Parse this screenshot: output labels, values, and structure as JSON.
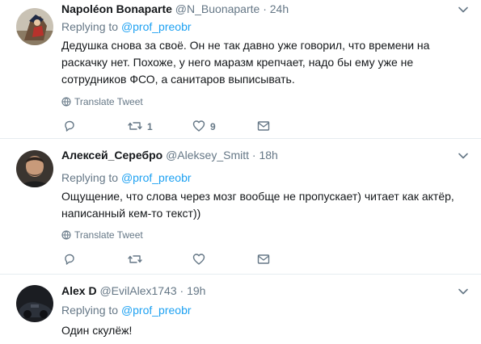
{
  "icons": {
    "caret": "chevron-down-icon",
    "translate": "globe-icon",
    "reply": "reply-icon",
    "retweet": "retweet-icon",
    "like": "heart-icon",
    "dm": "envelope-icon"
  },
  "colors": {
    "link": "#1da1f2",
    "secondary_text": "#657786",
    "primary_text": "#14171a",
    "divider": "#e6ecf0"
  },
  "tweets": [
    {
      "name": "Napoléon Bonaparte",
      "handle": "@N_Buonaparte",
      "dot": "·",
      "time": "24h",
      "replying_prefix": "Replying to",
      "replying_to": "@prof_preobr",
      "lines": [
        "Дедушка снова за своё. Он не так давно уже говорил, что времени на",
        "раскачку нет. Похоже, у него маразм крепчает, надо бы ему уже не",
        "сотрудников ФСО, а санитаров выписывать."
      ],
      "translate": "Translate Tweet",
      "retweets": "1",
      "likes": "9"
    },
    {
      "name": "Алексей_Серебро",
      "handle": "@Aleksey_Smitt",
      "dot": "·",
      "time": "18h",
      "replying_prefix": "Replying to",
      "replying_to": "@prof_preobr",
      "lines": [
        "Ощущение, что слова через мозг вообще не пропускает) читает как актёр,",
        "написанный кем-то текст))"
      ],
      "translate": "Translate Tweet",
      "retweets": "",
      "likes": ""
    },
    {
      "name": "Alex D",
      "handle": "@EvilAlex1743",
      "dot": "·",
      "time": "19h",
      "replying_prefix": "Replying to",
      "replying_to": "@prof_preobr",
      "lines": [
        "Один скулёж!"
      ]
    }
  ]
}
